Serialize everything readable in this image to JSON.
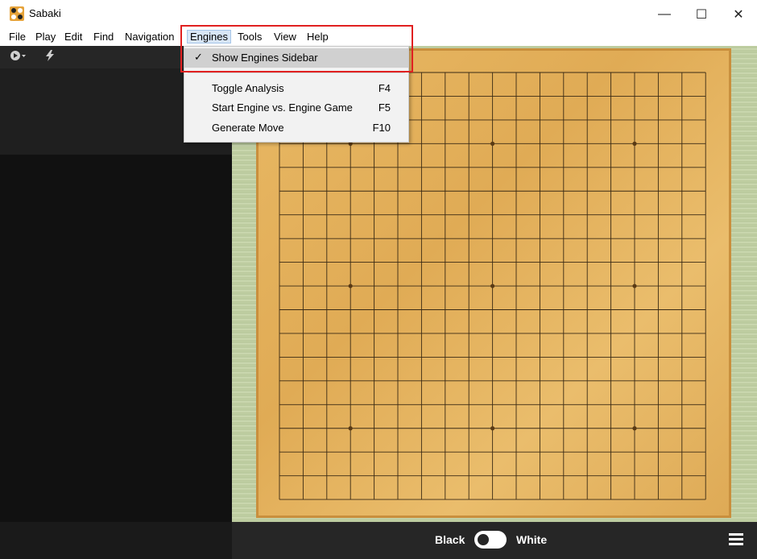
{
  "window": {
    "title": "Sabaki",
    "controls": {
      "minimize": "—",
      "maximize": "☐",
      "close": "✕"
    }
  },
  "menubar": {
    "items": [
      {
        "label": "File"
      },
      {
        "label": "Play"
      },
      {
        "label": "Edit"
      },
      {
        "label": "Find"
      },
      {
        "label": "Navigation"
      },
      {
        "label": "Engines"
      },
      {
        "label": "Tools"
      },
      {
        "label": "View"
      },
      {
        "label": "Help"
      }
    ]
  },
  "engines_menu": {
    "items": [
      {
        "label": "Show Engines Sidebar",
        "checked": true,
        "accel": ""
      },
      {
        "label": "Toggle Analysis",
        "accel": "F4"
      },
      {
        "label": "Start Engine vs. Engine Game",
        "accel": "F5"
      },
      {
        "label": "Generate Move",
        "accel": "F10"
      }
    ],
    "check_glyph": "✓"
  },
  "toolbar": {
    "play_icon": "play-dropdown-icon",
    "flash_icon": "flash-icon"
  },
  "board": {
    "size": 19,
    "star_points": [
      [
        3,
        3
      ],
      [
        3,
        9
      ],
      [
        3,
        15
      ],
      [
        9,
        3
      ],
      [
        9,
        9
      ],
      [
        9,
        15
      ],
      [
        15,
        3
      ],
      [
        15,
        9
      ],
      [
        15,
        15
      ]
    ]
  },
  "status_bar": {
    "black_label": "Black",
    "white_label": "White",
    "menu_icon": "hamburger-menu-icon"
  },
  "colors": {
    "board": "#e4b05c",
    "sidebar": "#111111",
    "highlight_box": "#e02020"
  }
}
